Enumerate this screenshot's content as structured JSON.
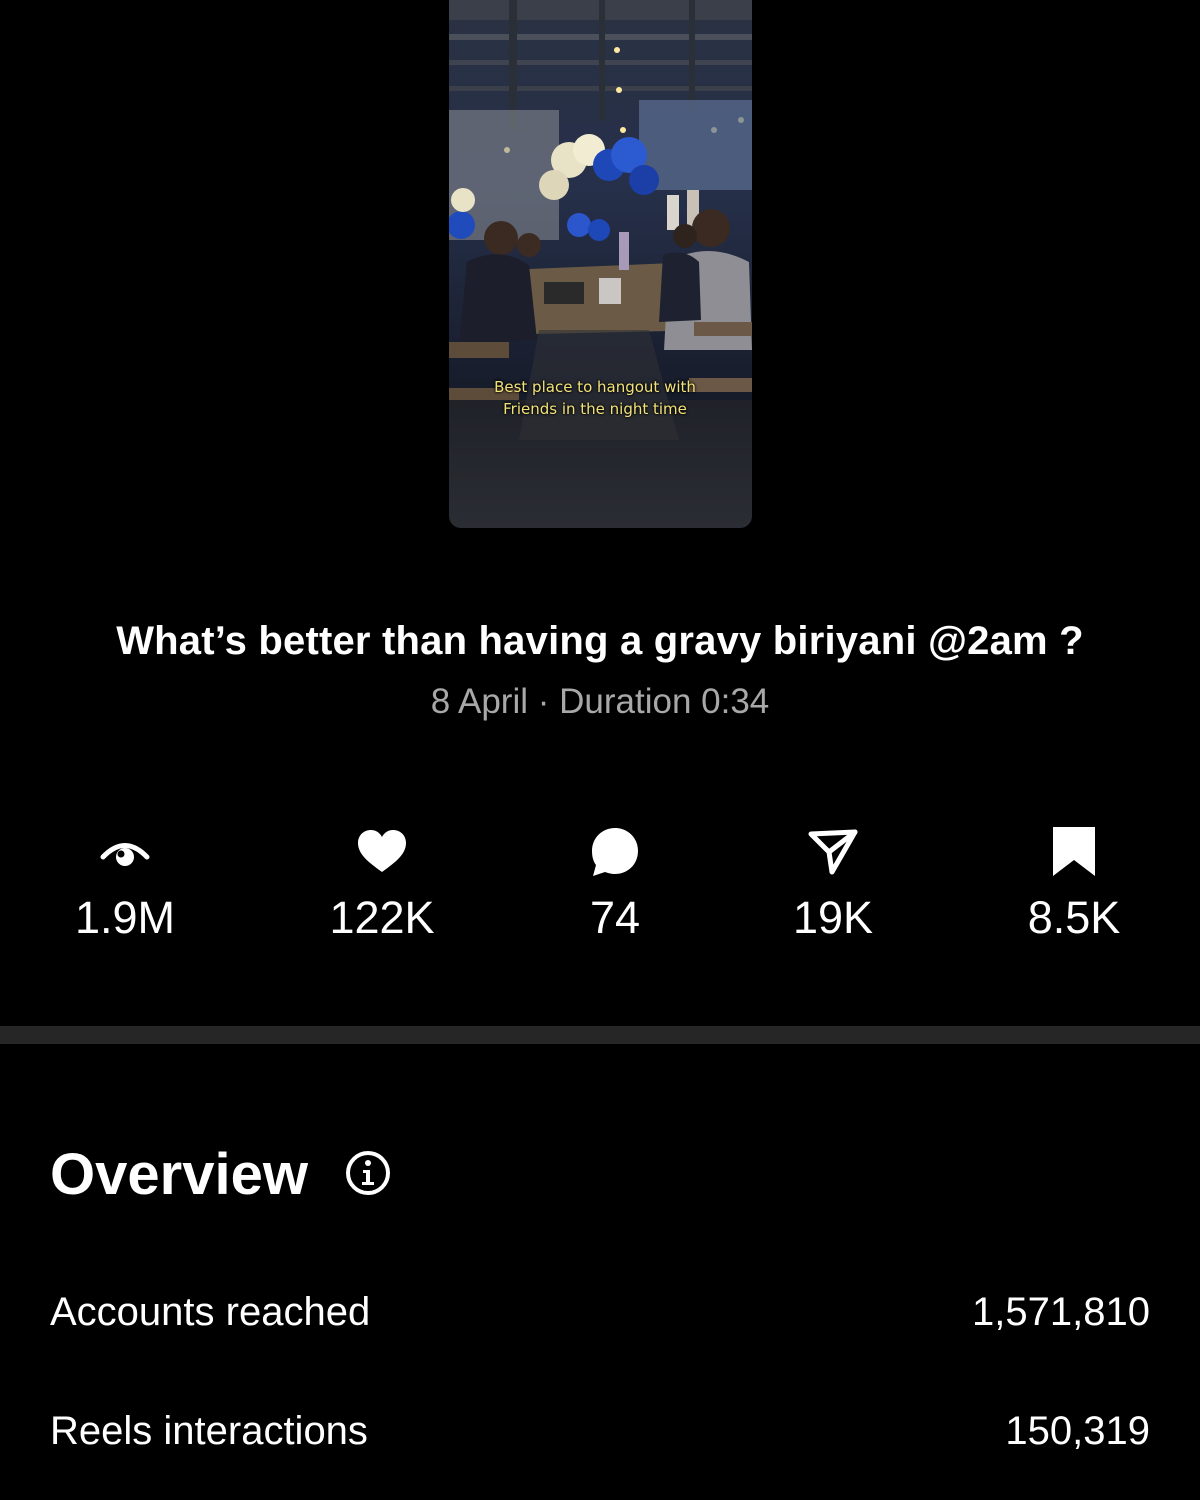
{
  "reel": {
    "caption_line1": "Best place to hangout with",
    "caption_line2": "Friends in the night time",
    "title": "What’s better than having a gravy biriyani @2am ?",
    "date": "8 April",
    "separator": "·",
    "duration": "Duration 0:34"
  },
  "stats": [
    {
      "icon": "views-icon",
      "value": "1.9M"
    },
    {
      "icon": "heart-icon",
      "value": "122K"
    },
    {
      "icon": "comment-icon",
      "value": "74"
    },
    {
      "icon": "share-icon",
      "value": "19K"
    },
    {
      "icon": "bookmark-icon",
      "value": "8.5K"
    }
  ],
  "overview": {
    "title": "Overview",
    "rows": [
      {
        "label": "Accounts reached",
        "value": "1,571,810"
      },
      {
        "label": "Reels interactions",
        "value": "150,319"
      }
    ]
  },
  "colors": {
    "background": "#000000",
    "text": "#ffffff",
    "secondary_text": "#a8a8a8",
    "divider": "#262626",
    "caption": "#f2e27a"
  }
}
